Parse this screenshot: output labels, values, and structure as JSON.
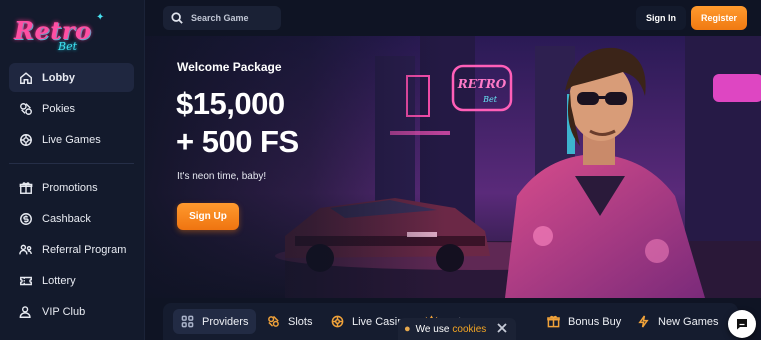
{
  "brand": {
    "logo_main": "Retro",
    "logo_sub": "Bet"
  },
  "sidebar": {
    "primary": [
      {
        "label": "Lobby",
        "icon": "home-icon"
      },
      {
        "label": "Pokies",
        "icon": "pokies-icon"
      },
      {
        "label": "Live Games",
        "icon": "live-games-icon"
      }
    ],
    "secondary": [
      {
        "label": "Promotions",
        "icon": "gift-icon"
      },
      {
        "label": "Cashback",
        "icon": "cashback-icon"
      },
      {
        "label": "Referral Program",
        "icon": "referral-icon"
      },
      {
        "label": "Lottery",
        "icon": "lottery-icon"
      },
      {
        "label": "VIP Club",
        "icon": "vip-icon"
      }
    ]
  },
  "header": {
    "search_placeholder": "Search Game",
    "signin_label": "Sign In",
    "register_label": "Register"
  },
  "hero": {
    "eyebrow": "Welcome Package",
    "amount": "$15,000",
    "free_spins": "+ 500 FS",
    "tagline": "It's neon time, baby!",
    "cta_label": "Sign Up"
  },
  "categories": [
    {
      "label": "Providers",
      "icon": "grid-icon"
    },
    {
      "label": "Slots",
      "icon": "slots-icon"
    },
    {
      "label": "Live Casin",
      "icon": "live-casino-icon"
    },
    {
      "label": "pot",
      "icon": "jackpot-icon"
    },
    {
      "label": "Bonus Buy",
      "icon": "bonus-buy-icon"
    },
    {
      "label": "New Games",
      "icon": "lightning-icon"
    }
  ],
  "cookie_banner": {
    "text": "We use",
    "link": "cookies"
  },
  "colors": {
    "accent": "#f5a623",
    "bg": "#0f1424",
    "sidebar": "#131a2c",
    "neon_pink": "#ff4fa3",
    "neon_cyan": "#3fe0f0"
  }
}
